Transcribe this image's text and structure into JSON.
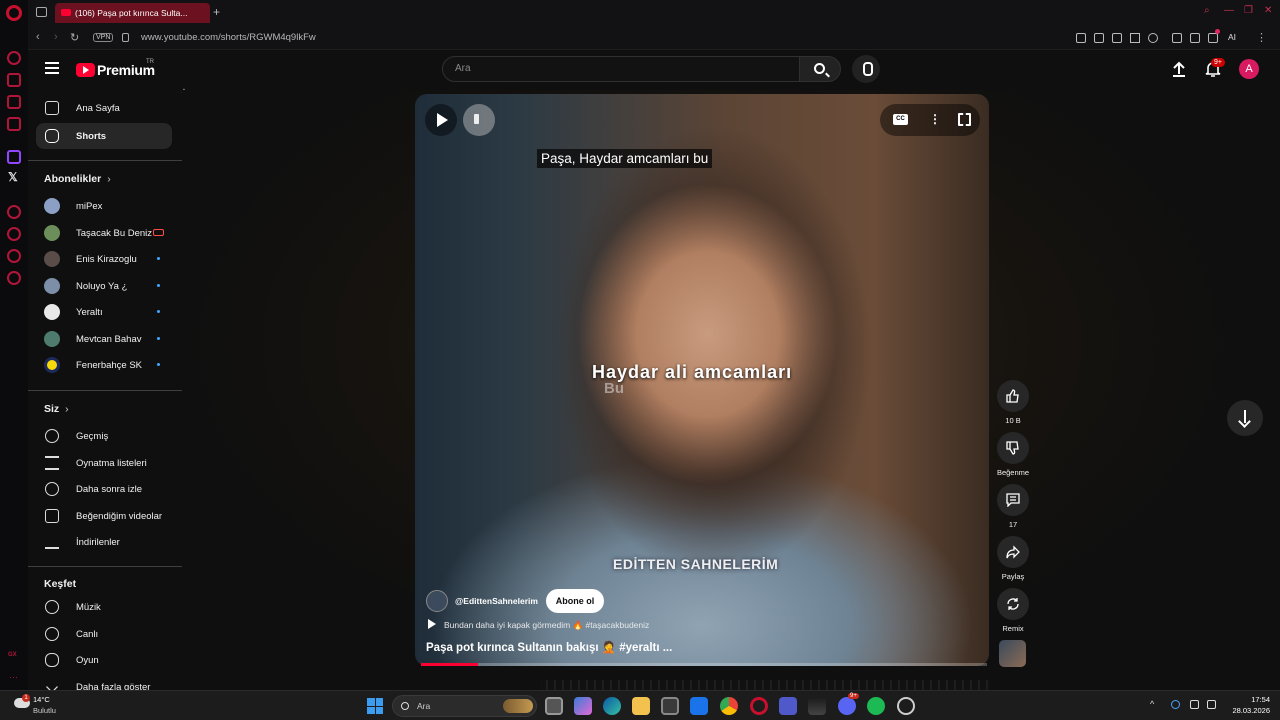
{
  "browser": {
    "tab_title": "(106) Paşa pot kırınca Sulta...",
    "new_tab_glyph": "+",
    "vpn_label": "VPN",
    "url": "www.youtube.com/shorts/RGWM4q9lkFw",
    "ai_label": "AI",
    "notif_count": "9+",
    "accent": "#c8102e"
  },
  "header": {
    "logo_text": "Premium",
    "logo_region": "TR",
    "search_placeholder": "Ara",
    "notifications_badge": "9+",
    "avatar_letter": "A"
  },
  "guide": {
    "primary": [
      {
        "label": "Ana Sayfa",
        "icon": "home-icon"
      },
      {
        "label": "Shorts",
        "icon": "shorts-icon",
        "active": true
      }
    ],
    "subscriptions_title": "Abonelikler",
    "subscriptions": [
      {
        "label": "miPex",
        "indicator": "none"
      },
      {
        "label": "Taşacak Bu Deniz",
        "indicator": "live"
      },
      {
        "label": "Enis Kirazoglu",
        "indicator": "dot"
      },
      {
        "label": "Noluyo Ya ¿",
        "indicator": "dot"
      },
      {
        "label": "Yeraltı",
        "indicator": "dot"
      },
      {
        "label": "Mevtcan Bahav",
        "indicator": "dot"
      },
      {
        "label": "Fenerbahçe SK",
        "indicator": "dot"
      }
    ],
    "you_title": "Siz",
    "you": [
      {
        "label": "Geçmiş",
        "icon": "history-icon"
      },
      {
        "label": "Oynatma listeleri",
        "icon": "playlists-icon"
      },
      {
        "label": "Daha sonra izle",
        "icon": "watch-later-icon"
      },
      {
        "label": "Beğendiğim videolar",
        "icon": "liked-videos-icon"
      },
      {
        "label": "İndirilenler",
        "icon": "downloads-icon"
      }
    ],
    "explore_title": "Keşfet",
    "explore": [
      {
        "label": "Müzik",
        "icon": "music-icon"
      },
      {
        "label": "Canlı",
        "icon": "live-icon"
      },
      {
        "label": "Oyun",
        "icon": "gaming-icon"
      },
      {
        "label": "Daha fazla göster",
        "icon": "chevron-down-icon"
      }
    ]
  },
  "short": {
    "caption": "Paşa, Haydar amcamları bu",
    "overlay_text": "Haydar ali amcamları",
    "overlay_ghost": "Bu",
    "watermark": "EDİTTEN SAHNELERİM",
    "channel_handle": "@EdittenSahnelerim",
    "subscribe_label": "Abone ol",
    "suggestion": "Bundan daha iyi kapak görmedim 🔥 #taşacakbudeniz",
    "title": "Paşa pot kırınca Sultanın bakışı 🤦 #yeraltı ...",
    "progress": 0.1,
    "cc_label": "CC"
  },
  "actions": {
    "likes": "10 B",
    "dislike_label": "Beğenme",
    "comments": "17",
    "share_label": "Paylaş",
    "remix_label": "Remix"
  },
  "taskbar": {
    "temp": "14°C",
    "condition": "Bulutlu",
    "weather_badge": "1",
    "search_placeholder": "Ara",
    "time": "17:54",
    "date": "28.03.2026",
    "discord_badge": "9+"
  }
}
